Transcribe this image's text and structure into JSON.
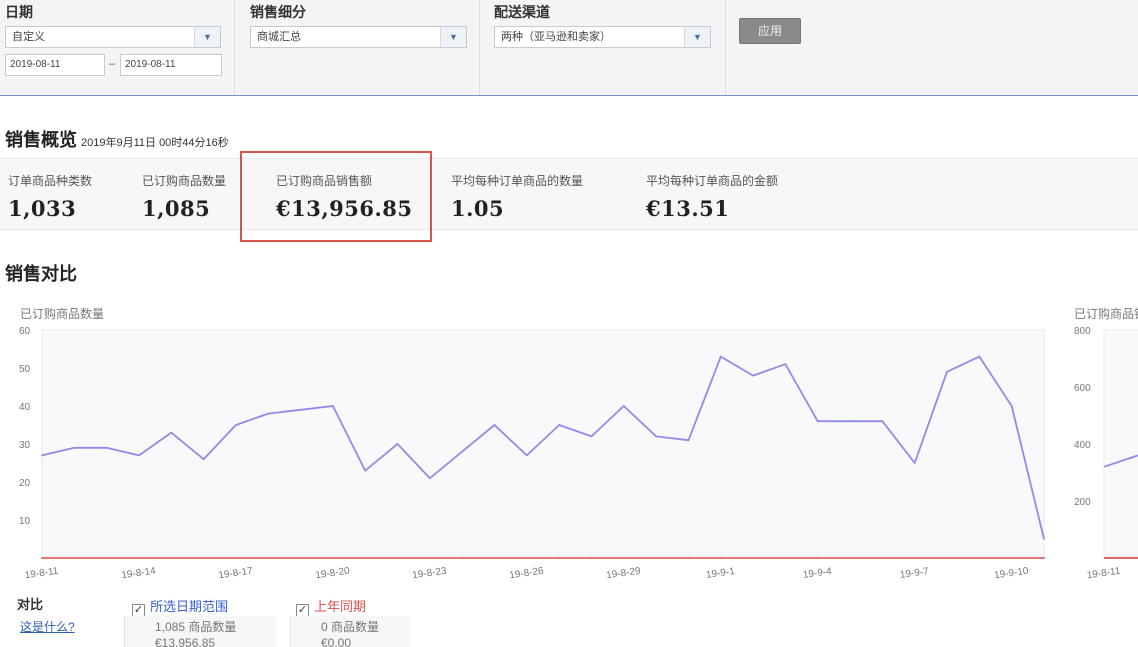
{
  "filters": {
    "date": {
      "label": "日期",
      "preset": "自定义",
      "start": "2019-08-11",
      "end": "2019-08-11",
      "separator": "–"
    },
    "segment": {
      "label": "销售细分",
      "value": "商城汇总"
    },
    "channel": {
      "label": "配送渠道",
      "value": "两种（亚马逊和卖家）"
    },
    "apply_label": "应用"
  },
  "overview": {
    "title": "销售概览",
    "timestamp": "2019年9月11日 00时44分16秒",
    "metrics": [
      {
        "label": "订单商品种类数",
        "value": "1,033"
      },
      {
        "label": "已订购商品数量",
        "value": "1,085"
      },
      {
        "label": "已订购商品销售额",
        "value": "€13,956.85",
        "highlighted": true
      },
      {
        "label": "平均每种订单商品的数量",
        "value": "1.05"
      },
      {
        "label": "平均每种订单商品的金额",
        "value": "€13.51"
      }
    ],
    "highlight_color": "#d9534f"
  },
  "comparison": {
    "title": "销售对比",
    "left_chart_label": "已订购商品数量",
    "right_chart_label": "已订购商品销售额"
  },
  "chart_data": [
    {
      "type": "line",
      "title": "",
      "ylabel": "已订购商品数量",
      "ylim": [
        0,
        60
      ],
      "yticks": [
        "60",
        "50",
        "40",
        "30",
        "20",
        "10"
      ],
      "ytick_values": [
        60,
        50,
        40,
        30,
        20,
        10
      ],
      "xticks": [
        "19-8-11",
        "19-8-14",
        "19-8-17",
        "19-8-20",
        "19-8-23",
        "19-8-26",
        "19-8-29",
        "19-9-1",
        "19-9-4",
        "19-9-7",
        "19-9-10"
      ],
      "xtick_indices": [
        0,
        3,
        6,
        9,
        12,
        15,
        18,
        21,
        24,
        27,
        30
      ],
      "grid": false,
      "series": [
        {
          "name": "所选日期范围",
          "color": "#8f8be8",
          "values": [
            27,
            29,
            29,
            27,
            33,
            26,
            35,
            38,
            39,
            40,
            23,
            30,
            21,
            28,
            35,
            27,
            35,
            32,
            40,
            32,
            31,
            53,
            48,
            51,
            36,
            36,
            36,
            25,
            49,
            53,
            40,
            5
          ]
        },
        {
          "name": "上年同期",
          "color": "#d9534f",
          "values": [
            0,
            0,
            0,
            0,
            0,
            0,
            0,
            0,
            0,
            0,
            0,
            0,
            0,
            0,
            0,
            0,
            0,
            0,
            0,
            0,
            0,
            0,
            0,
            0,
            0,
            0,
            0,
            0,
            0,
            0,
            0,
            0
          ]
        }
      ]
    },
    {
      "type": "line",
      "title": "",
      "ylabel": "已订购商品销售额",
      "ylim": [
        0,
        800
      ],
      "yticks": [
        "800",
        "600",
        "400",
        "200"
      ],
      "ytick_values": [
        800,
        600,
        400,
        200
      ],
      "xticks": [
        "19-8-11"
      ],
      "grid": false,
      "series": [
        {
          "name": "所选日期范围",
          "color": "#8f8be8",
          "values": [
            320,
            360
          ]
        },
        {
          "name": "上年同期",
          "color": "#d9534f",
          "values": [
            0,
            0
          ]
        }
      ]
    }
  ],
  "legend": {
    "title": "对比",
    "help_link": "这是什么?",
    "items": [
      {
        "label": "所选日期范围",
        "color": "#3b5fd0",
        "checked": true,
        "line1": "1,085 商品数量",
        "line2": "€13,956.85"
      },
      {
        "label": "上年同期",
        "color": "#d9534f",
        "checked": true,
        "line1": "0 商品数量",
        "line2": "€0.00"
      }
    ],
    "check_glyph": "✓"
  }
}
